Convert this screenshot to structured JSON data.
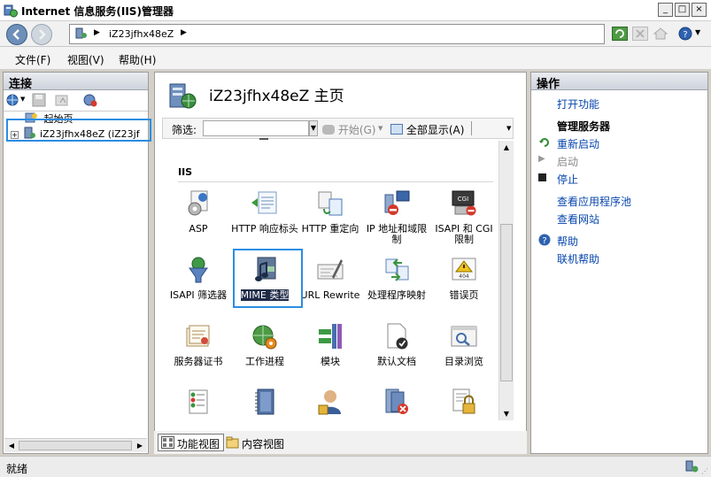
{
  "window": {
    "title": "Internet 信息服务(IIS)管理器",
    "controls": [
      "minimize",
      "maximize",
      "close"
    ]
  },
  "address": {
    "crumbs": [
      "iZ23jfhx48eZ"
    ],
    "icons": [
      "server-icon",
      "refresh-icon",
      "stop-icon",
      "home-icon",
      "help-icon"
    ]
  },
  "menu": {
    "items": [
      "文件(F)",
      "视图(V)",
      "帮助(H)"
    ]
  },
  "connections": {
    "title": "连接",
    "tree": [
      {
        "label": "起始页"
      },
      {
        "label": "iZ23jfhx48eZ (iZ23jf"
      }
    ]
  },
  "home": {
    "title": "iZ23jfhx48eZ 主页",
    "filter_label": "筛选:",
    "filter_value": "",
    "start_label": "开始(G)",
    "show_all_label": "全部显示(A)",
    "group_name": "IIS",
    "features": [
      {
        "label": "ASP",
        "icon": "asp-icon"
      },
      {
        "label": "HTTP 响应标头",
        "icon": "http-response-headers-icon"
      },
      {
        "label": "HTTP 重定向",
        "icon": "http-redirect-icon"
      },
      {
        "label": "IP 地址和域限制",
        "icon": "ip-restrictions-icon"
      },
      {
        "label": "ISAPI 和 CGI 限制",
        "icon": "isapi-cgi-icon"
      },
      {
        "label": "ISAPI 筛选器",
        "icon": "isapi-filters-icon"
      },
      {
        "label": "MIME 类型",
        "icon": "mime-types-icon",
        "selected": true
      },
      {
        "label": "URL Rewrite",
        "icon": "url-rewrite-icon"
      },
      {
        "label": "处理程序映射",
        "icon": "handler-mappings-icon"
      },
      {
        "label": "错误页",
        "icon": "error-pages-icon"
      },
      {
        "label": "服务器证书",
        "icon": "server-certificates-icon"
      },
      {
        "label": "工作进程",
        "icon": "worker-processes-icon"
      },
      {
        "label": "模块",
        "icon": "modules-icon"
      },
      {
        "label": "默认文档",
        "icon": "default-document-icon"
      },
      {
        "label": "目录浏览",
        "icon": "directory-browsing-icon"
      },
      {
        "label": "",
        "icon": "authentication-icon"
      },
      {
        "label": "",
        "icon": "logging-icon"
      },
      {
        "label": "",
        "icon": "authorization-icon"
      },
      {
        "label": "",
        "icon": "request-filtering-icon"
      },
      {
        "label": "",
        "icon": "ssl-settings-icon"
      }
    ],
    "views": [
      {
        "label": "功能视图",
        "active": true
      },
      {
        "label": "内容视图",
        "active": false
      }
    ]
  },
  "actions": {
    "title": "操作",
    "open_feature": "打开功能",
    "manage_server": "管理服务器",
    "restart": "重新启动",
    "start": "启动",
    "stop": "停止",
    "view_app_pools": "查看应用程序池",
    "view_sites": "查看网站",
    "help": "帮助",
    "online_help": "联机帮助"
  },
  "status": {
    "text": "就绪"
  },
  "colors": {
    "selection": "#2b8de2",
    "link": "#0645ad",
    "mime_highlight": "#1f2a47"
  }
}
